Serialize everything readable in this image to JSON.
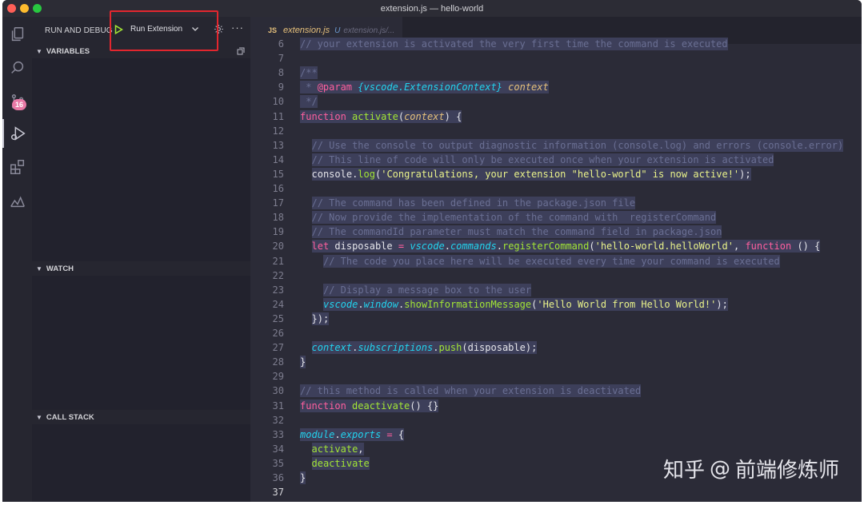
{
  "window": {
    "title": "extension.js — hello-world"
  },
  "activitybar": {
    "scm_badge": "16"
  },
  "sidebar": {
    "title": "RUN AND DEBUG",
    "run_config": "Run Extension",
    "more": "···",
    "sections": {
      "variables": "VARIABLES",
      "watch": "WATCH",
      "call_stack": "CALL STACK"
    }
  },
  "editor": {
    "tab": {
      "lang": "JS",
      "filename": "extension.js",
      "status": "U",
      "path": "extension.js/..."
    },
    "lines": [
      {
        "n": "6",
        "text": "// your extension is activated the very first time the command is executed"
      },
      {
        "n": "7",
        "text": ""
      },
      {
        "n": "8",
        "text": "/**"
      },
      {
        "n": "9",
        "text": " * @param {vscode.ExtensionContext} context"
      },
      {
        "n": "10",
        "text": " */"
      },
      {
        "n": "11",
        "text": "function activate(context) {"
      },
      {
        "n": "12",
        "text": ""
      },
      {
        "n": "13",
        "text": "// Use the console to output diagnostic information (console.log) and errors (console.error)"
      },
      {
        "n": "14",
        "text": "// This line of code will only be executed once when your extension is activated"
      },
      {
        "n": "15",
        "text": "console.log('Congratulations, your extension \"hello-world\" is now active!');"
      },
      {
        "n": "16",
        "text": ""
      },
      {
        "n": "17",
        "text": "// The command has been defined in the package.json file"
      },
      {
        "n": "18",
        "text": "// Now provide the implementation of the command with  registerCommand"
      },
      {
        "n": "19",
        "text": "// The commandId parameter must match the command field in package.json"
      },
      {
        "n": "20",
        "text": "let disposable = vscode.commands.registerCommand('hello-world.helloWorld', function () {"
      },
      {
        "n": "21",
        "text": "// The code you place here will be executed every time your command is executed"
      },
      {
        "n": "22",
        "text": ""
      },
      {
        "n": "23",
        "text": "// Display a message box to the user"
      },
      {
        "n": "24",
        "text": "vscode.window.showInformationMessage('Hello World from Hello World!');"
      },
      {
        "n": "25",
        "text": "});"
      },
      {
        "n": "26",
        "text": ""
      },
      {
        "n": "27",
        "text": "context.subscriptions.push(disposable);"
      },
      {
        "n": "28",
        "text": "}"
      },
      {
        "n": "29",
        "text": ""
      },
      {
        "n": "30",
        "text": "// this method is called when your extension is deactivated"
      },
      {
        "n": "31",
        "text": "function deactivate() {}"
      },
      {
        "n": "32",
        "text": ""
      },
      {
        "n": "33",
        "text": "module.exports = {"
      },
      {
        "n": "34",
        "text": "activate,"
      },
      {
        "n": "35",
        "text": "deactivate"
      },
      {
        "n": "36",
        "text": "}"
      },
      {
        "n": "37",
        "text": ""
      }
    ]
  },
  "watermark": {
    "site": "知乎",
    "handle": "前端修炼师"
  },
  "colors": {
    "highlight_box": "#e3262e",
    "badge": "#e879a6",
    "accent_green": "#a3e635"
  }
}
